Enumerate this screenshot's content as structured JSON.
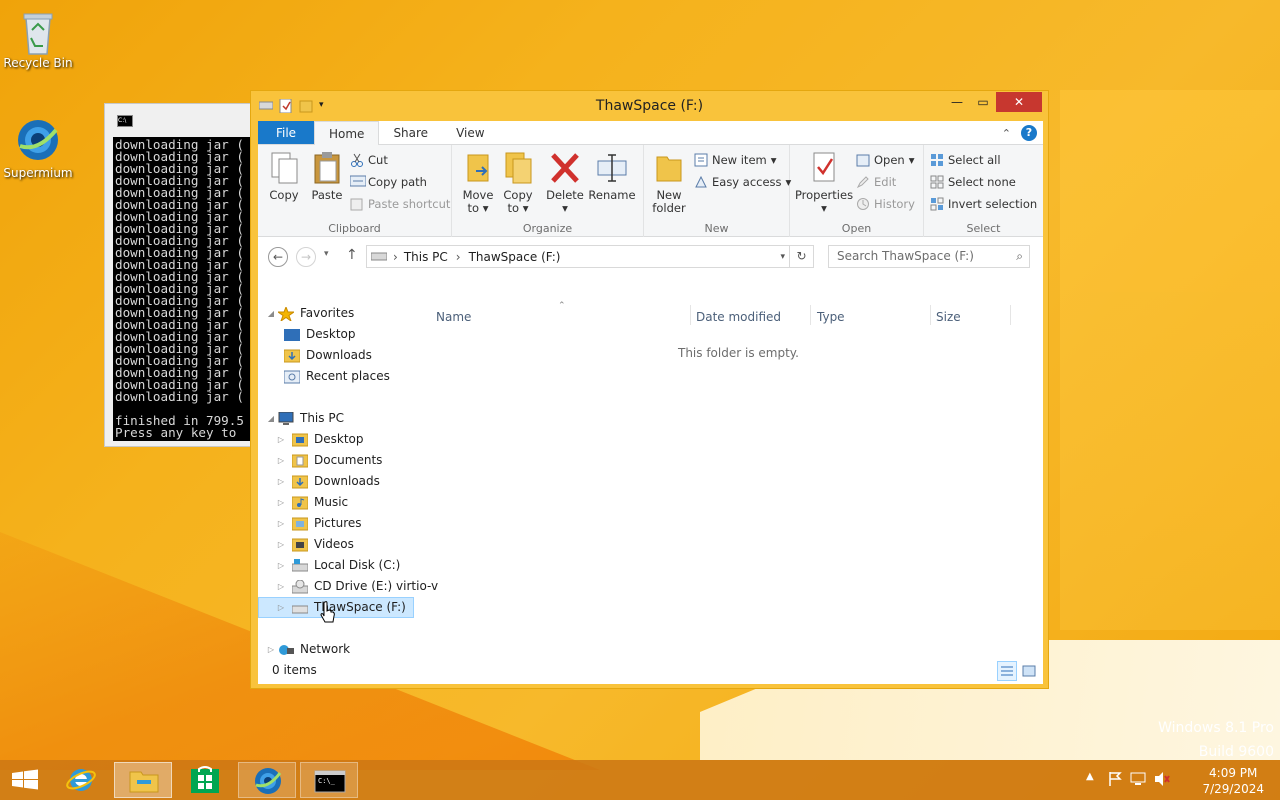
{
  "desktop": {
    "icons": [
      {
        "label": "Recycle Bin"
      },
      {
        "label": "Supermium"
      }
    ],
    "watermark": {
      "line1": "Windows 8.1 Pro",
      "line2": "Build 9600"
    }
  },
  "console": {
    "icon_text": "C:\\",
    "lines": [
      "downloading jar (",
      "downloading jar (",
      "downloading jar (",
      "downloading jar (",
      "downloading jar (",
      "downloading jar (",
      "downloading jar (",
      "downloading jar (",
      "downloading jar (",
      "downloading jar (",
      "downloading jar (",
      "downloading jar (",
      "downloading jar (",
      "downloading jar (",
      "downloading jar (",
      "downloading jar (",
      "downloading jar (",
      "downloading jar (",
      "downloading jar (",
      "downloading jar (",
      "downloading jar (",
      "downloading jar (",
      "",
      "finished in 799.5",
      "Press any key to"
    ]
  },
  "explorer": {
    "title": "ThawSpace (F:)",
    "tabs": {
      "file": "File",
      "home": "Home",
      "share": "Share",
      "view": "View"
    },
    "ribbon": {
      "clipboard": {
        "label": "Clipboard",
        "copy": "Copy",
        "paste": "Paste",
        "cut": "Cut",
        "copy_path": "Copy path",
        "paste_shortcut": "Paste shortcut"
      },
      "organize": {
        "label": "Organize",
        "move_to": "Move",
        "move_to2": "to",
        "copy_to": "Copy",
        "copy_to2": "to",
        "delete": "Delete",
        "rename": "Rename"
      },
      "new": {
        "label": "New",
        "new_folder": "New",
        "new_folder2": "folder",
        "new_item": "New item",
        "easy_access": "Easy access"
      },
      "open": {
        "label": "Open",
        "properties": "Properties",
        "open": "Open",
        "edit": "Edit",
        "history": "History"
      },
      "select": {
        "label": "Select",
        "select_all": "Select all",
        "select_none": "Select none",
        "invert": "Invert selection"
      }
    },
    "address": {
      "crumbs": [
        "This PC",
        "ThawSpace (F:)"
      ],
      "search_placeholder": "Search ThawSpace (F:)"
    },
    "nav": {
      "favorites": "Favorites",
      "fav_items": [
        "Desktop",
        "Downloads",
        "Recent places"
      ],
      "this_pc": "This PC",
      "pc_items": [
        "Desktop",
        "Documents",
        "Downloads",
        "Music",
        "Pictures",
        "Videos",
        "Local Disk (C:)",
        "CD Drive (E:) virtio-v",
        "ThawSpace (F:)"
      ],
      "network": "Network"
    },
    "columns": {
      "name": "Name",
      "date": "Date modified",
      "type": "Type",
      "size": "Size"
    },
    "empty_text": "This folder is empty.",
    "status": {
      "items": "0 items"
    }
  },
  "taskbar": {
    "clock": {
      "time": "4:09 PM",
      "date": "7/29/2024"
    }
  }
}
